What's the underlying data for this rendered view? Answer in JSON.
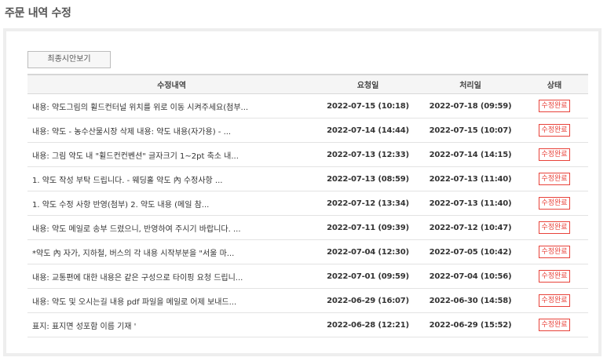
{
  "page": {
    "title": "주문 내역 수정"
  },
  "toolbar": {
    "preview_label": "최종시안보기"
  },
  "table": {
    "headers": {
      "content": "수정내역",
      "requested": "요청일",
      "processed": "처리일",
      "status": "상태"
    },
    "rows": [
      {
        "content": "내용: 약도그림의 휠드컨터널 위치를 위로 이동 시켜주세요(첨부...",
        "requested": "2022-07-15 (10:18)",
        "processed": "2022-07-18 (09:59)",
        "status": "수정완료"
      },
      {
        "content": "내용: 약도 - 농수산물시장 삭제 내용: 약도 내용(자가용) - ...",
        "requested": "2022-07-14 (14:44)",
        "processed": "2022-07-15 (10:07)",
        "status": "수정완료"
      },
      {
        "content": "내용: 그림 약도 내 \"휠드컨컨벤션\" 글자크기 1~2pt 축소 내...",
        "requested": "2022-07-13 (12:33)",
        "processed": "2022-07-14 (14:15)",
        "status": "수정완료"
      },
      {
        "content": "1. 약도 작성 부탁 드립니다. - 웨딩홀 약도 內 수정사항 ...",
        "requested": "2022-07-13 (08:59)",
        "processed": "2022-07-13 (11:40)",
        "status": "수정완료"
      },
      {
        "content": "1. 약도 수정 사항 반영(첨부) 2. 약도 내용 (메일 참...",
        "requested": "2022-07-12 (13:34)",
        "processed": "2022-07-13 (11:40)",
        "status": "수정완료"
      },
      {
        "content": "내용: 약도 메일로 송부 드렸으니, 반영하여 주시기 바랍니다. ...",
        "requested": "2022-07-11 (09:39)",
        "processed": "2022-07-12 (10:47)",
        "status": "수정완료"
      },
      {
        "content": "*약도 內 자가, 지하철, 버스의 각 내용 시작부분을 \"서울 마...",
        "requested": "2022-07-04 (12:30)",
        "processed": "2022-07-05 (10:42)",
        "status": "수정완료"
      },
      {
        "content": "내용: 교통편에 대한 내용은 같은 구성으로 타이핑 요청 드립니...",
        "requested": "2022-07-01 (09:59)",
        "processed": "2022-07-04 (10:56)",
        "status": "수정완료"
      },
      {
        "content": "내용: 약도 및 오시는길 내용 pdf 파일을 메일로 어제 보내드...",
        "requested": "2022-06-29 (16:07)",
        "processed": "2022-06-30 (14:58)",
        "status": "수정완료"
      },
      {
        "content": "표지: 표지면 성포함 이름 기재 '",
        "requested": "2022-06-28 (12:21)",
        "processed": "2022-06-29 (15:52)",
        "status": "수정완료"
      }
    ]
  },
  "colors": {
    "status_accent": "#e8423a",
    "panel_border": "#eeeeee"
  }
}
